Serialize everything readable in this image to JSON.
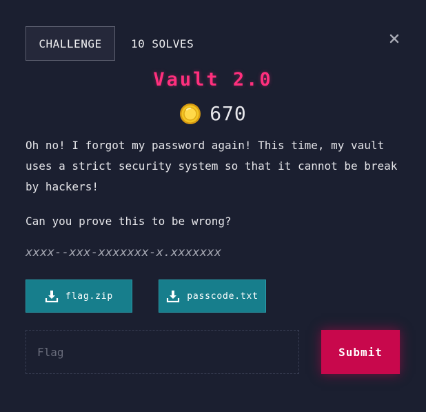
{
  "tabs": {
    "challenge_label": "CHALLENGE",
    "solves_label": "10 SOLVES"
  },
  "close": {
    "icon": "close-icon"
  },
  "challenge": {
    "title": "Vault 2.0",
    "points": "670",
    "coin_icon": "coin-icon",
    "description": [
      "Oh no! I forgot my password again! This time, my vault uses a strict security system so that it cannot be break by hackers!",
      "Can you prove this to be wrong?"
    ],
    "flag_format": "xxxx--xxx-xxxxxxx-x.xxxxxxx"
  },
  "files": [
    {
      "name": "flag.zip",
      "icon": "download-icon"
    },
    {
      "name": "passcode.txt",
      "icon": "download-icon"
    }
  ],
  "submit_form": {
    "placeholder": "Flag",
    "submit_label": "Submit"
  },
  "colors": {
    "background": "#1b1f30",
    "title": "#ff2f7d",
    "file_button": "#177e8c",
    "submit_button": "#c8084c",
    "coin": "#f3c623"
  }
}
